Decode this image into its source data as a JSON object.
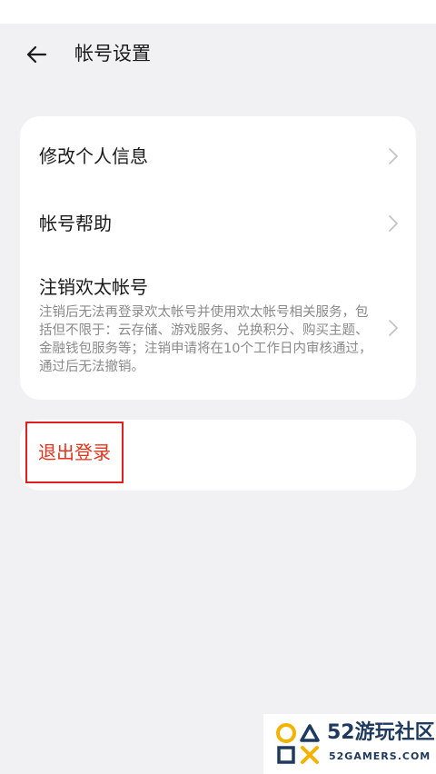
{
  "header": {
    "title": "帐号设置",
    "back_icon": "arrow-left-icon"
  },
  "account_card": {
    "items": [
      {
        "label": "修改个人信息",
        "icon": "chevron-right-icon"
      },
      {
        "label": "帐号帮助",
        "icon": "chevron-right-icon"
      },
      {
        "label": "注销欢太帐号",
        "description": "注销后无法再登录欢太帐号并使用欢太帐号相关服务，包括但不限于：云存储、游戏服务、兑换积分、购买主题、金融钱包服务等；注销申请将在10个工作日内审核通过，通过后无法撤销。",
        "icon": "chevron-right-icon"
      }
    ]
  },
  "logout": {
    "label": "退出登录",
    "color": "#e8331a",
    "highlight_color": "#e02020"
  },
  "watermark": {
    "title": "52游玩社区",
    "subtitle": "52GAMERS.COM"
  },
  "colors": {
    "background": "#f1f1f3",
    "card": "#ffffff",
    "secondary_text": "#8a8a8a"
  }
}
